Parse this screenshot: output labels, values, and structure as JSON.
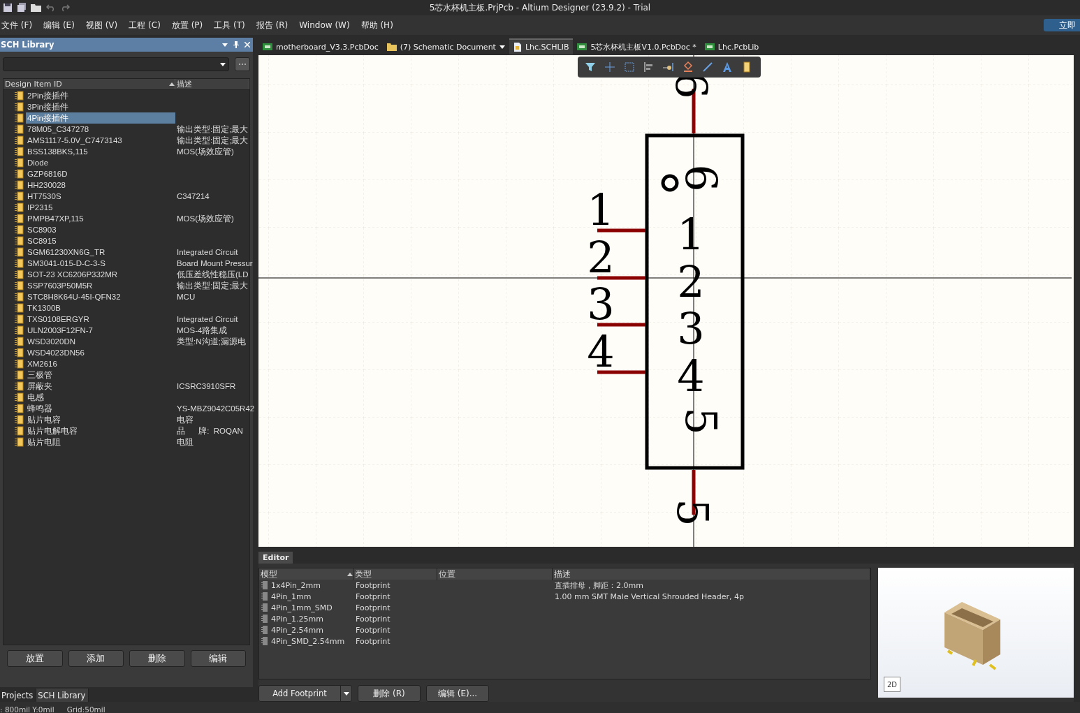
{
  "window": {
    "title": "5芯水杯机主板.PrjPcb - Altium Designer (23.9.2) - Trial",
    "account_button": "立即"
  },
  "menu": [
    "文件 (F)",
    "编辑 (E)",
    "视图 (V)",
    "工程 (C)",
    "放置 (P)",
    "工具 (T)",
    "报告 (R)",
    "Window (W)",
    "帮助 (H)"
  ],
  "panel": {
    "title": "SCH Library",
    "columns": [
      "Design Item ID",
      "描述"
    ],
    "items": [
      {
        "id": "2Pin接插件",
        "selected": false
      },
      {
        "id": "3Pin接插件",
        "selected": false
      },
      {
        "id": "4Pin接插件",
        "selected": true
      },
      {
        "id": "78M05_C347278",
        "description": "输出类型:固定;最大",
        "selected": false
      },
      {
        "id": "AMS1117-5.0V_C7473143",
        "description": "输出类型:固定;最大",
        "selected": false
      },
      {
        "id": "BSS138BKS,115",
        "description": "MOS(场效应管)",
        "selected": false
      },
      {
        "id": "Diode",
        "selected": false
      },
      {
        "id": "GZP6816D",
        "selected": false
      },
      {
        "id": "HH230028",
        "selected": false
      },
      {
        "id": "HT7530S",
        "description": "C347214",
        "selected": false
      },
      {
        "id": "IP2315",
        "selected": false
      },
      {
        "id": "PMPB47XP,115",
        "description": "MOS(场效应管)",
        "selected": false
      },
      {
        "id": "SC8903",
        "selected": false
      },
      {
        "id": "SC8915",
        "selected": false
      },
      {
        "id": "SGM61230XN6G_TR",
        "description": "Integrated Circuit",
        "selected": false
      },
      {
        "id": "SM3041-015-D-C-3-S",
        "description": "Board Mount Pressur",
        "selected": false
      },
      {
        "id": "SOT-23 XC6206P332MR",
        "description": "低压差线性稳压(LD",
        "selected": false
      },
      {
        "id": "SSP7603P50M5R",
        "description": "输出类型:固定;最大",
        "selected": false
      },
      {
        "id": "STC8H8K64U-45I-QFN32",
        "description": "MCU",
        "selected": false
      },
      {
        "id": "TK1300B",
        "selected": false
      },
      {
        "id": "TXS0108ERGYR",
        "description": "Integrated Circuit",
        "selected": false
      },
      {
        "id": "ULN2003F12FN-7",
        "description": "MOS-4路集成",
        "selected": false
      },
      {
        "id": "WSD3020DN",
        "description": "类型:N沟道;漏源电",
        "selected": false
      },
      {
        "id": "WSD4023DN56",
        "selected": false
      },
      {
        "id": "XM2616",
        "selected": false
      },
      {
        "id": "三极管",
        "selected": false
      },
      {
        "id": "屏蔽夹",
        "description": "ICSRC3910SFR",
        "selected": false
      },
      {
        "id": "电感",
        "selected": false
      },
      {
        "id": "蜂鸣器",
        "description": "YS-MBZ9042C05R42",
        "selected": false
      },
      {
        "id": "贴片电容",
        "description": "电容",
        "selected": false
      },
      {
        "id": "贴片电解电容",
        "description": "品      牌:  ROQAN",
        "selected": false
      },
      {
        "id": "贴片电阻",
        "description": "电阻",
        "selected": false
      }
    ],
    "buttons": [
      "放置",
      "添加",
      "删除",
      "编辑"
    ],
    "tabs": [
      {
        "label": "Projects",
        "selected": false
      },
      {
        "label": "SCH Library",
        "selected": true
      }
    ]
  },
  "documents": [
    {
      "label": "motherboard_V3.3.PcbDoc",
      "kind": "pcb",
      "selected": false
    },
    {
      "label": "(7) Schematic Document",
      "kind": "folder",
      "selected": false
    },
    {
      "label": "Lhc.SCHLIB",
      "kind": "schlib",
      "selected": true
    },
    {
      "label": "5芯水杯机主板V1.0.PcbDoc *",
      "kind": "pcb",
      "selected": false
    },
    {
      "label": "Lhc.PcbLib",
      "kind": "pcblib",
      "selected": false
    }
  ],
  "component": {
    "pins": [
      {
        "number": "1",
        "name": "1",
        "kind": "left"
      },
      {
        "number": "2",
        "name": "2",
        "kind": "left"
      },
      {
        "number": "3",
        "name": "3",
        "kind": "left"
      },
      {
        "number": "4",
        "name": "4",
        "kind": "left"
      },
      {
        "number": "5",
        "name": "5",
        "kind": "bottom"
      },
      {
        "number": "6",
        "name": "6",
        "kind": "top"
      }
    ]
  },
  "editor": {
    "title": "Editor",
    "columns": [
      "模型",
      "类型",
      "位置",
      "描述"
    ],
    "rows": [
      {
        "model": "1x4Pin_2mm",
        "type": "Footprint",
        "description": "直插排母，脚距：2.0mm"
      },
      {
        "model": "4Pin_1mm",
        "type": "Footprint",
        "description": "1.00 mm SMT Male Vertical Shrouded Header, 4p"
      },
      {
        "model": "4Pin_1mm_SMD",
        "type": "Footprint"
      },
      {
        "model": "4Pin_1.25mm",
        "type": "Footprint"
      },
      {
        "model": "4Pin_2.54mm",
        "type": "Footprint"
      },
      {
        "model": "4Pin_SMD_2.54mm",
        "type": "Footprint"
      }
    ],
    "add_button": "Add Footprint",
    "buttons": [
      "删除 (R)",
      "编辑 (E)..."
    ],
    "view_button": "2D"
  },
  "status_bar": {
    "position": ": 800mil Y:0mil",
    "grid": "Grid:50mil"
  }
}
